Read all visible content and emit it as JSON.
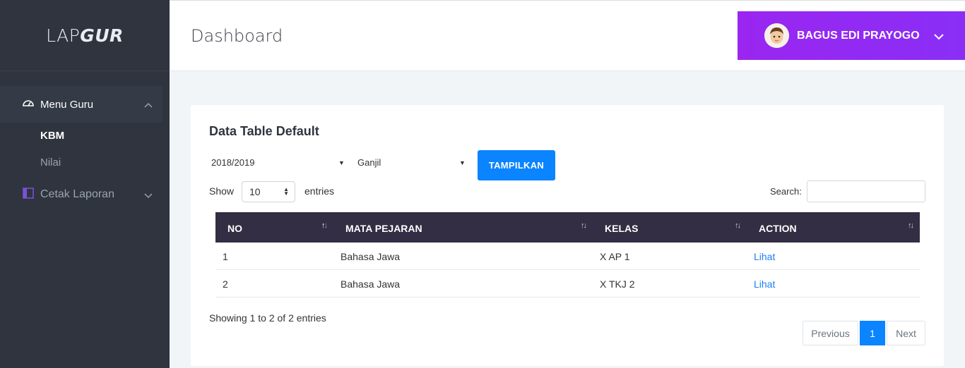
{
  "brand": {
    "light": "LAP",
    "bold": "GUR"
  },
  "header": {
    "title": "Dashboard",
    "user_name": "BAGUS EDI PRAYOGO"
  },
  "sidebar": {
    "menu_guru": {
      "label": "Menu Guru",
      "items": [
        {
          "label": "KBM"
        },
        {
          "label": "Nilai"
        }
      ]
    },
    "cetak": {
      "label": "Cetak Laporan"
    }
  },
  "card": {
    "title": "Data Table Default",
    "year_select": "2018/2019",
    "semester_select": "Ganjil",
    "button": "TAMPILKAN",
    "show": "Show",
    "page_length": "10",
    "entries": "entries",
    "search_label": "Search:"
  },
  "table": {
    "headers": [
      "NO",
      "MATA PEJARAN",
      "KELAS",
      "ACTION"
    ],
    "rows": [
      {
        "no": "1",
        "mapel": "Bahasa Jawa",
        "kelas": "X AP 1",
        "action": "Lihat"
      },
      {
        "no": "2",
        "mapel": "Bahasa Jawa",
        "kelas": "X TKJ 2",
        "action": "Lihat"
      }
    ],
    "info": "Showing 1 to 2 of 2 entries"
  },
  "pagination": {
    "prev": "Previous",
    "current": "1",
    "next": "Next"
  },
  "colors": {
    "sidebar": "#2f343f",
    "accent": "#0a84ff",
    "user_box": "#9a26f0",
    "table_head": "#332e43"
  }
}
